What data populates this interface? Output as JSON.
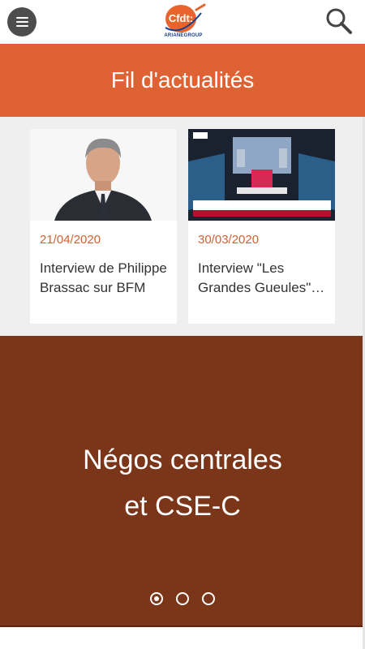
{
  "header": {
    "menu_icon": "hamburger-menu-icon",
    "logo_text": "Cfdt:",
    "logo_subtext": "ARIANEGROUP",
    "search_icon": "search-icon",
    "colors": {
      "menu_button": "#4d4d4d",
      "logo_orange": "#e8642c",
      "logo_blue": "#1b3f8f"
    }
  },
  "hero": {
    "title": "Fil d'actualités",
    "color": "#de6233"
  },
  "news": {
    "items": [
      {
        "date": "21/04/2020",
        "title": "Interview de Philippe Brassac sur BFM",
        "image": "portrait-photo"
      },
      {
        "date": "30/03/2020",
        "title": "Interview \"Les Grandes Gueules\" RMC",
        "image": "tv-studio-photo"
      }
    ],
    "date_color": "#d3602f"
  },
  "slider": {
    "title_line1": "Négos centrales",
    "title_line2": "et CSE-C",
    "color": "#7b3518",
    "dots_total": 3,
    "active_dot": 1
  }
}
